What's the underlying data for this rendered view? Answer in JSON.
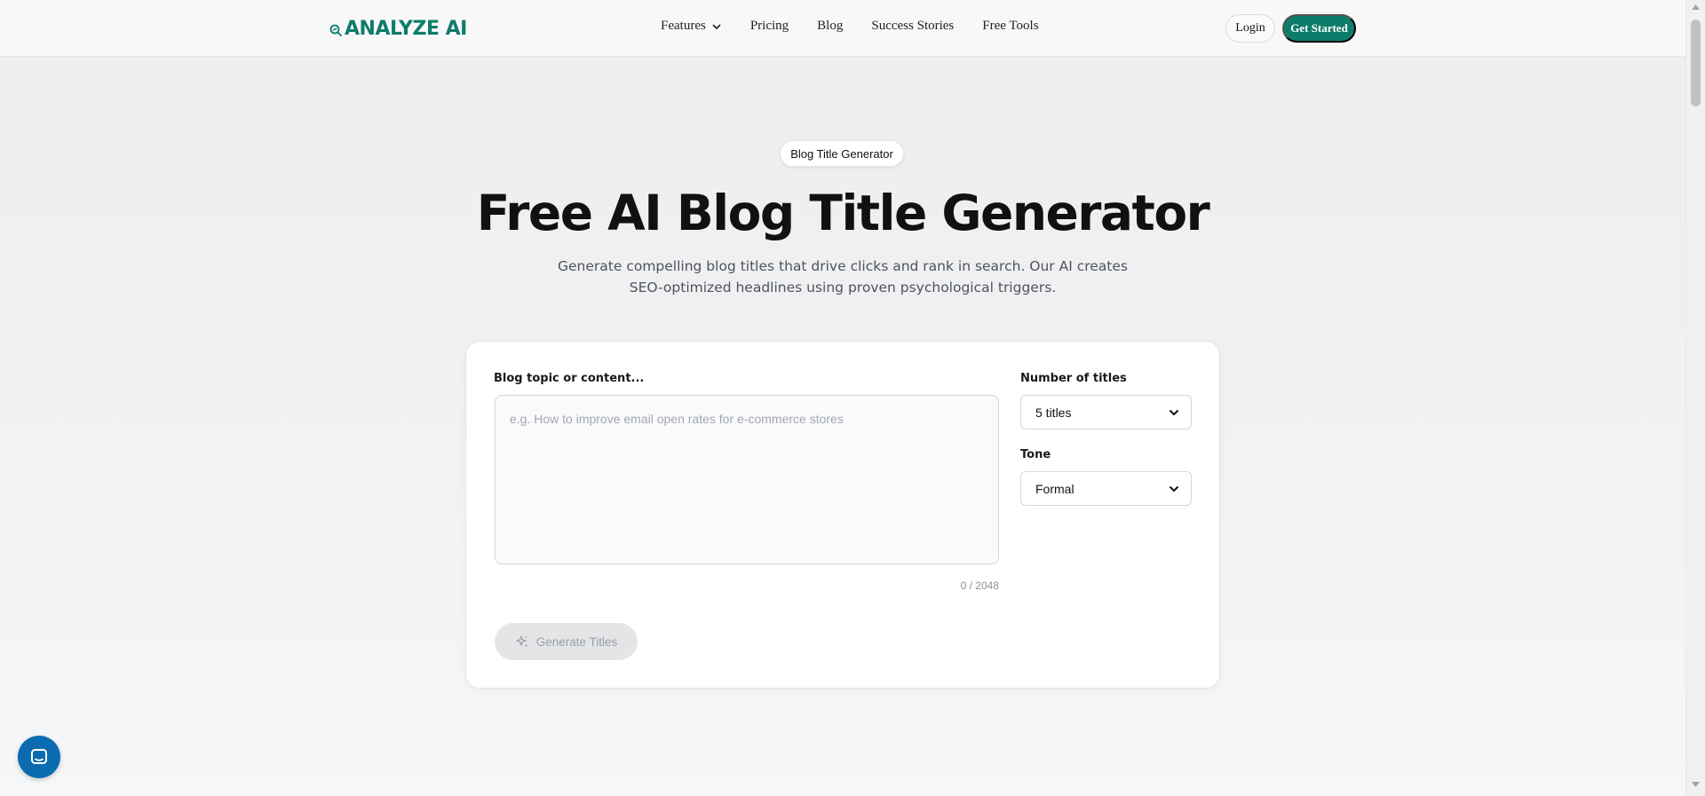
{
  "brand": {
    "name": "ANALYZE AI",
    "color": "#0e7c6b"
  },
  "nav": {
    "items": [
      {
        "label": "Features",
        "has_dropdown": true
      },
      {
        "label": "Pricing"
      },
      {
        "label": "Blog"
      },
      {
        "label": "Success Stories"
      },
      {
        "label": "Free Tools"
      }
    ],
    "login_label": "Login",
    "cta_label": "Get Started"
  },
  "hero": {
    "badge": "Blog Title Generator",
    "title": "Free AI Blog Title Generator",
    "subtitle": "Generate compelling blog titles that drive clicks and rank in search. Our AI creates SEO-optimized headlines using proven psychological triggers."
  },
  "form": {
    "topic_label": "Blog topic or content...",
    "topic_placeholder": "e.g. How to improve email open rates for e-commerce stores",
    "topic_value": "",
    "char_counter": "0 / 2048",
    "count_label": "Number of titles",
    "count_value": "5 titles",
    "tone_label": "Tone",
    "tone_value": "Formal",
    "generate_label": "Generate Titles"
  },
  "icons": {
    "logo": "magnifier-chart-icon",
    "dropdown": "chevron-down-icon",
    "generate": "sparkles-icon",
    "chat": "chat-bubble-icon"
  },
  "colors": {
    "accent": "#0e7c6b",
    "chat": "#0b6bb0"
  }
}
